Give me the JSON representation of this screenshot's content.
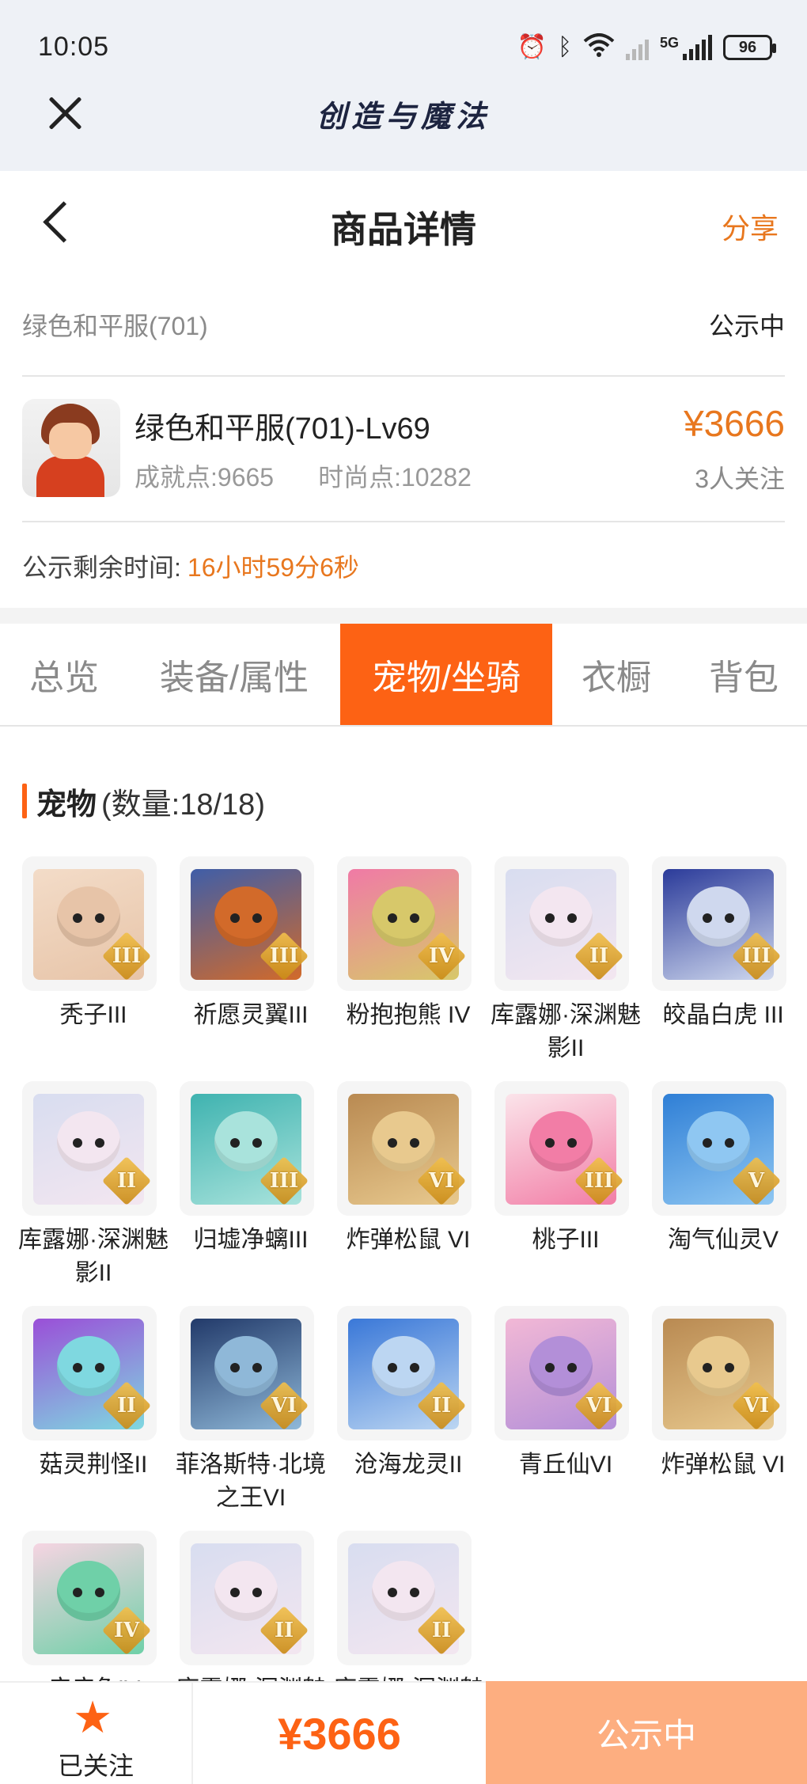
{
  "status_bar": {
    "time": "10:05",
    "battery": "96",
    "network": "5G"
  },
  "app": {
    "title": "创造与魔法"
  },
  "header": {
    "title": "商品详情",
    "share_label": "分享"
  },
  "item": {
    "name": "绿色和平服(701)",
    "status": "公示中",
    "title": "绿色和平服(701)-Lv69",
    "achievement": "成就点:9665",
    "fashion": "时尚点:10282",
    "price": "¥3666",
    "followers": "3人关注",
    "remaining_label": "公示剩余时间:",
    "remaining_value": "16小时59分6秒"
  },
  "tabs": [
    {
      "label": "总览",
      "active": false
    },
    {
      "label": "装备/属性",
      "active": false
    },
    {
      "label": "宠物/坐骑",
      "active": true
    },
    {
      "label": "衣橱",
      "active": false
    },
    {
      "label": "背包",
      "active": false
    }
  ],
  "pets_section": {
    "title": "宠物",
    "count": "(数量:18/18)"
  },
  "pets": [
    {
      "name": "秃子III",
      "tier": "III",
      "colors": [
        "#f3dcc8",
        "#e7c4a8"
      ]
    },
    {
      "name": "祈愿灵翼III",
      "tier": "III",
      "colors": [
        "#3f5ea8",
        "#d26a2a"
      ]
    },
    {
      "name": "粉抱抱熊 IV",
      "tier": "IV",
      "colors": [
        "#f07aa6",
        "#d7c86a"
      ]
    },
    {
      "name": "库露娜·深渊魅影II",
      "tier": "II",
      "colors": [
        "#d8ddf0",
        "#f3e6f0"
      ]
    },
    {
      "name": "皎晶白虎 III",
      "tier": "III",
      "colors": [
        "#2b3b9a",
        "#cfd8ee"
      ]
    },
    {
      "name": "库露娜·深渊魅影II",
      "tier": "II",
      "colors": [
        "#d8ddf0",
        "#f3e6f0"
      ]
    },
    {
      "name": "归墟净螭III",
      "tier": "III",
      "colors": [
        "#3fb3b0",
        "#a9e3dc"
      ]
    },
    {
      "name": "炸弹松鼠 VI",
      "tier": "VI",
      "colors": [
        "#b98a52",
        "#e8c98e"
      ]
    },
    {
      "name": "桃子III",
      "tier": "III",
      "colors": [
        "#fbe4ea",
        "#f27da6"
      ]
    },
    {
      "name": "淘气仙灵V",
      "tier": "V",
      "colors": [
        "#2f7fd6",
        "#8fc7f2"
      ]
    },
    {
      "name": "菇灵荆怪II",
      "tier": "II",
      "colors": [
        "#9a4fd8",
        "#7fd8e0"
      ]
    },
    {
      "name": "菲洛斯特·北境之王VI",
      "tier": "VI",
      "colors": [
        "#223a6a",
        "#8fb8d8"
      ]
    },
    {
      "name": "沧海龙灵II",
      "tier": "II",
      "colors": [
        "#3a78d8",
        "#bcd6f2"
      ]
    },
    {
      "name": "青丘仙VI",
      "tier": "VI",
      "colors": [
        "#f2b8d6",
        "#b38fd8"
      ]
    },
    {
      "name": "炸弹松鼠 VI",
      "tier": "VI",
      "colors": [
        "#b98a52",
        "#e8c98e"
      ]
    },
    {
      "name": "病病兔IV",
      "tier": "IV",
      "colors": [
        "#f6d4e2",
        "#6fd0a8"
      ]
    },
    {
      "name": "库露娜·深渊魅影II",
      "tier": "II",
      "colors": [
        "#d8ddf0",
        "#f3e6f0"
      ]
    },
    {
      "name": "库露娜·深渊魅影II",
      "tier": "II",
      "colors": [
        "#d8ddf0",
        "#f3e6f0"
      ]
    }
  ],
  "bottom_bar": {
    "follow_label": "已关注",
    "price": "¥3666",
    "status_label": "公示中"
  },
  "colors": {
    "accent": "#fd6214",
    "price": "#e8771e",
    "cta_disabled": "#fdae80"
  }
}
